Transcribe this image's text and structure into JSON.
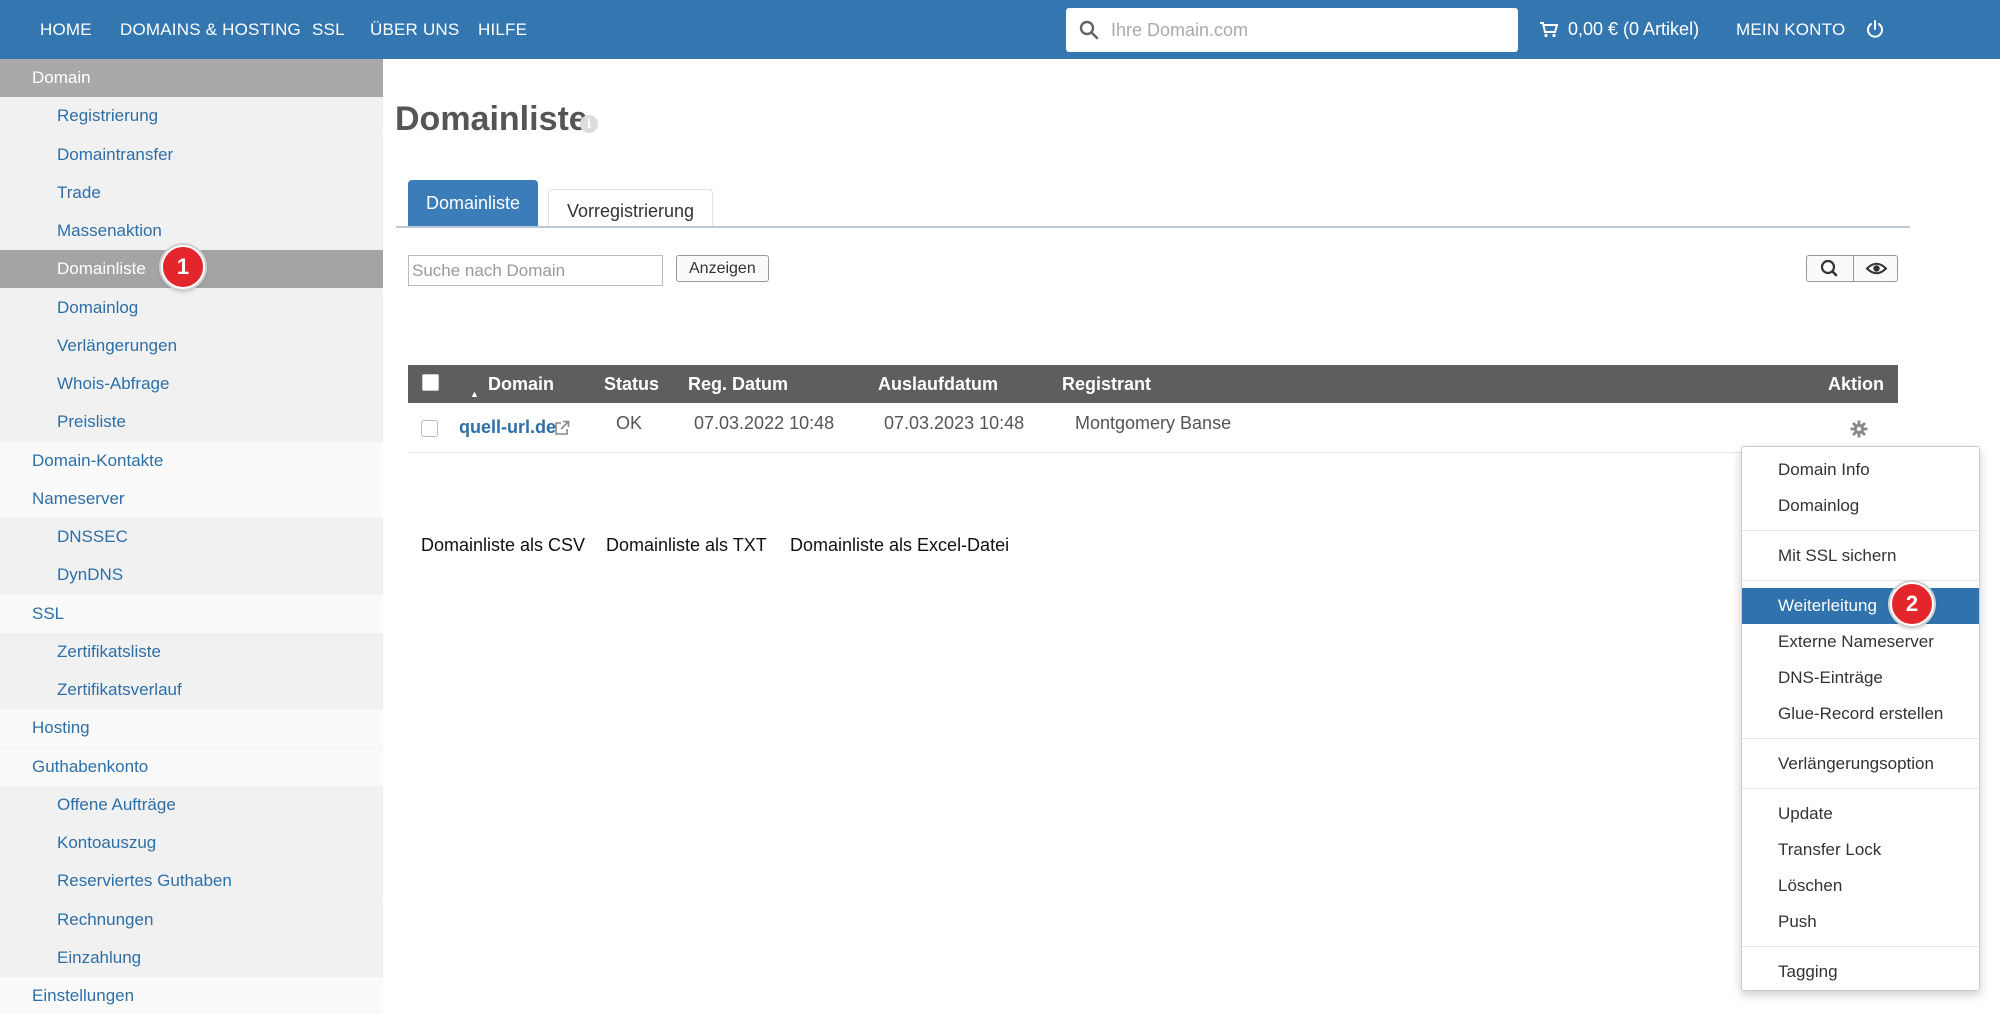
{
  "nav": {
    "items": [
      "HOME",
      "DOMAINS & HOSTING",
      "SSL",
      "ÜBER UNS",
      "HILFE"
    ],
    "search_placeholder": "Ihre Domain.com",
    "cart": "0,00 € (0 Artikel)",
    "account": "MEIN KONTO"
  },
  "sidebar": {
    "items": [
      {
        "label": "Domain",
        "level": 1,
        "style": "head"
      },
      {
        "label": "Registrierung",
        "level": 2
      },
      {
        "label": "Domaintransfer",
        "level": 2
      },
      {
        "label": "Trade",
        "level": 2
      },
      {
        "label": "Massenaktion",
        "level": 2
      },
      {
        "label": "Domainliste",
        "level": 2,
        "style": "active"
      },
      {
        "label": "Domainlog",
        "level": 2
      },
      {
        "label": "Verlängerungen",
        "level": 2
      },
      {
        "label": "Whois-Abfrage",
        "level": 2
      },
      {
        "label": "Preisliste",
        "level": 2
      },
      {
        "label": "Domain-Kontakte",
        "level": 1
      },
      {
        "label": "Nameserver",
        "level": 1
      },
      {
        "label": "DNSSEC",
        "level": 2
      },
      {
        "label": "DynDNS",
        "level": 2
      },
      {
        "label": "SSL",
        "level": 1
      },
      {
        "label": "Zertifikatsliste",
        "level": 2
      },
      {
        "label": "Zertifikatsverlauf",
        "level": 2
      },
      {
        "label": "Hosting",
        "level": 1
      },
      {
        "label": "Guthabenkonto",
        "level": 1
      },
      {
        "label": "Offene Aufträge",
        "level": 2
      },
      {
        "label": "Kontoauszug",
        "level": 2
      },
      {
        "label": "Reserviertes Guthaben",
        "level": 2
      },
      {
        "label": "Rechnungen",
        "level": 2
      },
      {
        "label": "Einzahlung",
        "level": 2
      },
      {
        "label": "Einstellungen",
        "level": 1
      }
    ]
  },
  "badges": {
    "one": "1",
    "two": "2"
  },
  "main": {
    "title": "Domainliste",
    "tabs": [
      "Domainliste",
      "Vorregistrierung"
    ],
    "filter_placeholder": "Suche nach Domain",
    "show_button": "Anzeigen"
  },
  "table": {
    "headers": {
      "domain": "Domain",
      "status": "Status",
      "reg": "Reg. Datum",
      "exp": "Auslaufdatum",
      "registrant": "Registrant",
      "action": "Aktion"
    },
    "rows": [
      {
        "domain": "quell-url.de",
        "status": "OK",
        "reg": "07.03.2022 10:48",
        "exp": "07.03.2023 10:48",
        "registrant": "Montgomery Banse"
      }
    ]
  },
  "exports": [
    "Domainliste als CSV",
    "Domainliste als TXT",
    "Domainliste als Excel-Datei"
  ],
  "dropdown": {
    "groups": [
      [
        "Domain Info",
        "Domainlog"
      ],
      [
        "Mit SSL sichern"
      ],
      [
        "Weiterleitung",
        "Externe Nameserver",
        "DNS-Einträge",
        "Glue-Record erstellen"
      ],
      [
        "Verlängerungsoption"
      ],
      [
        "Update",
        "Transfer Lock",
        "Löschen",
        "Push"
      ],
      [
        "Tagging"
      ]
    ],
    "active": "Weiterleitung"
  },
  "colors": {
    "nav": "#3376b0",
    "link": "#2d6fa8",
    "badge": "#e3262b",
    "active_menu": "#2f72ae"
  }
}
